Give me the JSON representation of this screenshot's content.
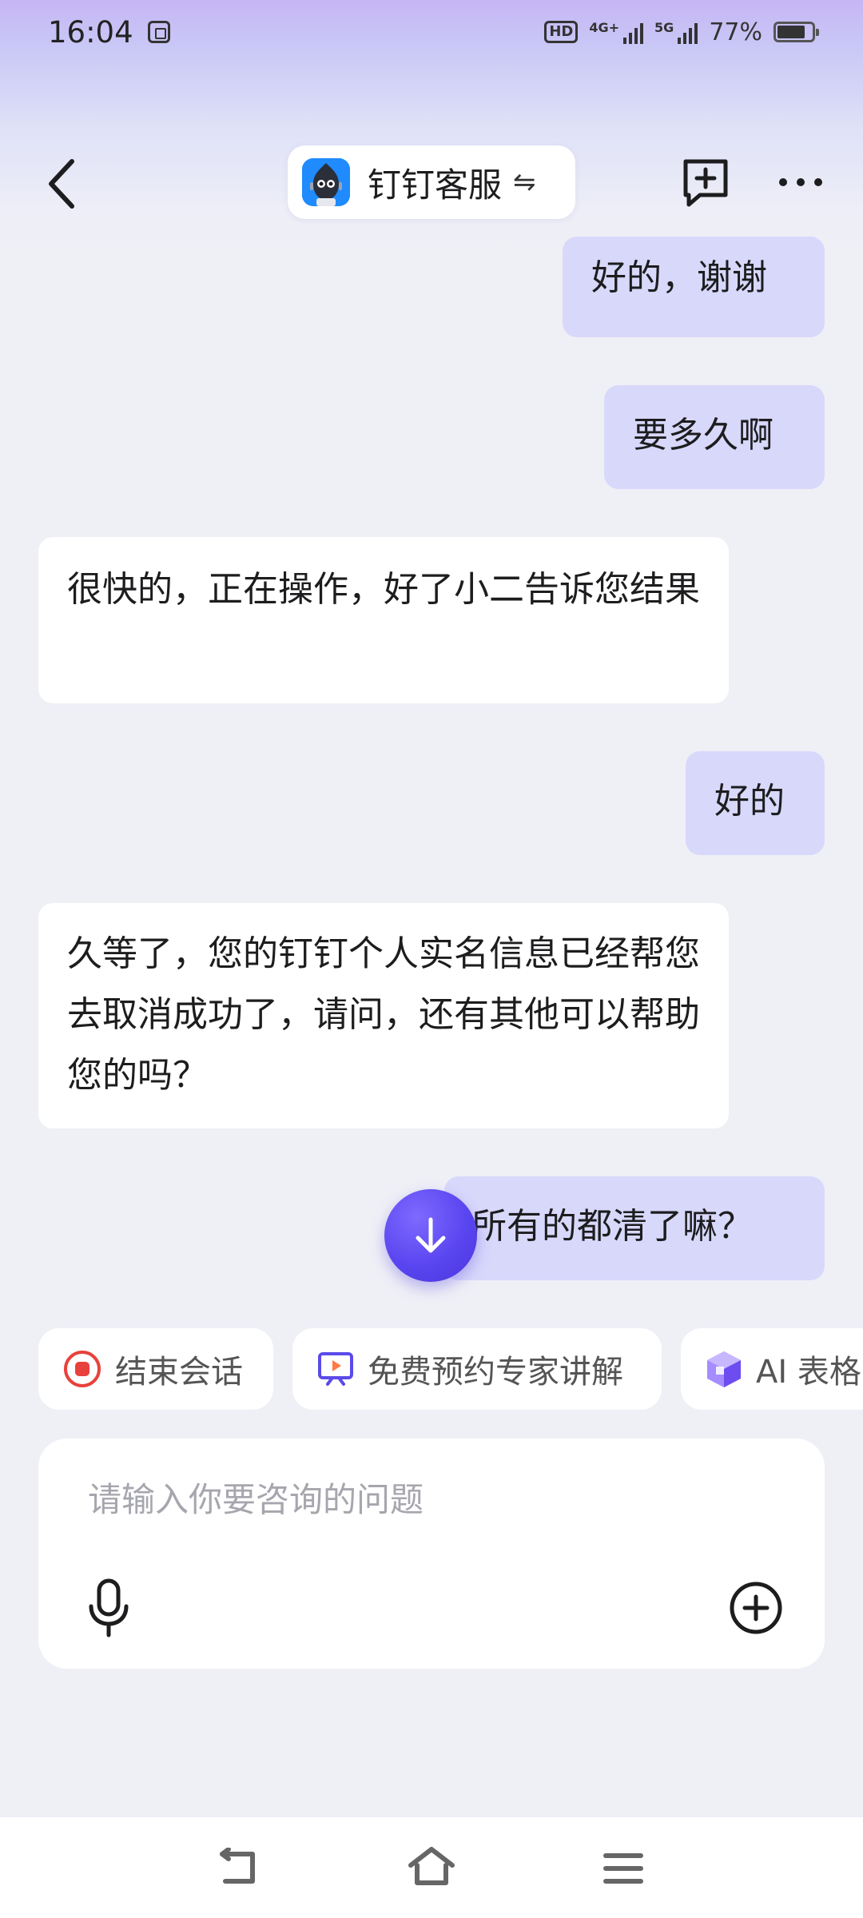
{
  "status_bar": {
    "time": "16:04",
    "network_hd": "HD",
    "network_4g": "4G+",
    "network_5g": "5G",
    "battery_percent": "77%",
    "battery_level": 0.77
  },
  "header": {
    "title": "钉钉客服",
    "switch_glyph": "⇋",
    "icons": {
      "back": "chevron-left-icon",
      "new_chat": "message-plus-icon",
      "more": "more-horizontal-icon"
    }
  },
  "messages": [
    {
      "role": "user",
      "text": "好的，谢谢"
    },
    {
      "role": "user",
      "text": "要多久啊"
    },
    {
      "role": "agent",
      "text": "很快的，正在操作，好了小二告诉您结果"
    },
    {
      "role": "user",
      "text": "好的"
    },
    {
      "role": "agent",
      "text": "久等了，您的钉钉个人实名信息已经帮您去取消成功了，请问，还有其他可以帮助您的吗？"
    },
    {
      "role": "user",
      "text": "所有的都清了嘛？"
    }
  ],
  "quick_actions": [
    {
      "label": "结束会话",
      "icon": "stop-circle-icon",
      "color": "#e8413c"
    },
    {
      "label": "免费预约专家讲解",
      "icon": "video-tv-icon",
      "color": "#5b4be8"
    },
    {
      "label": "AI 表格",
      "icon": "ai-table-cube-icon",
      "color": "#7b5cf0"
    }
  ],
  "input": {
    "placeholder": "请输入你要咨询的问题",
    "value": ""
  },
  "colors": {
    "user_bubble": "#d8d8fb",
    "agent_bubble": "#ffffff",
    "accent": "#5a46f0"
  }
}
